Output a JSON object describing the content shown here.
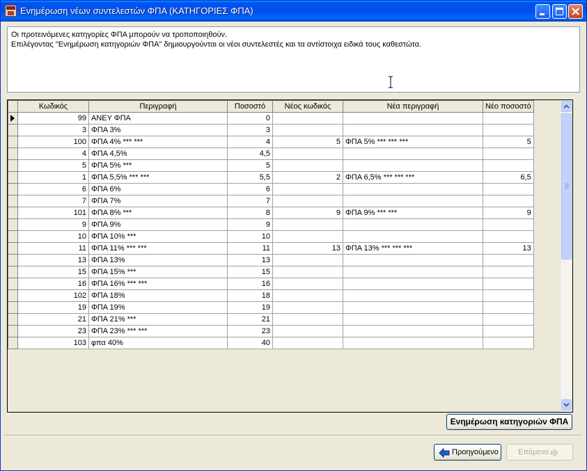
{
  "window": {
    "title": "Ενημέρωση νέων συντελεστών ΦΠΑ (ΚΑΤΗΓΟΡΙΕΣ ΦΠΑ)"
  },
  "message": {
    "line1": "Οι προτεινόμενες κατηγορίες ΦΠΑ μπορούν να τροποποιηθούν.",
    "line2": "Επιλέγοντας \"Ενημέρωση κατηγοριών ΦΠΑ\" δημιουργούνται οι νέοι συντελεστές και τα αντίστοιχα ειδικά τους καθεστώτα."
  },
  "grid": {
    "columns": [
      "Κωδικός",
      "Περιγραφή",
      "Ποσοστό",
      "Νέος κωδικός",
      "Νέα περιγραφή",
      "Νέο ποσοστό"
    ],
    "rows": [
      [
        "99",
        "ΑΝΕΥ ΦΠΑ",
        "0",
        "",
        "",
        ""
      ],
      [
        "3",
        "ΦΠΑ 3%",
        "3",
        "",
        "",
        ""
      ],
      [
        "100",
        "ΦΠΑ 4% *** ***",
        "4",
        "5",
        "ΦΠΑ 5% *** *** ***",
        "5"
      ],
      [
        "4",
        "ΦΠΑ 4,5%",
        "4,5",
        "",
        "",
        ""
      ],
      [
        "5",
        "ΦΠΑ 5% ***",
        "5",
        "",
        "",
        ""
      ],
      [
        "1",
        "ΦΠΑ 5,5% *** ***",
        "5,5",
        "2",
        "ΦΠΑ 6,5% *** *** ***",
        "6,5"
      ],
      [
        "6",
        "ΦΠΑ 6%",
        "6",
        "",
        "",
        ""
      ],
      [
        "7",
        "ΦΠΑ 7%",
        "7",
        "",
        "",
        ""
      ],
      [
        "101",
        "ΦΠΑ 8% ***",
        "8",
        "9",
        "ΦΠΑ 9% *** ***",
        "9"
      ],
      [
        "9",
        "ΦΠΑ 9%",
        "9",
        "",
        "",
        ""
      ],
      [
        "10",
        "ΦΠΑ 10% ***",
        "10",
        "",
        "",
        ""
      ],
      [
        "11",
        "ΦΠΑ 11% *** ***",
        "11",
        "13",
        "ΦΠΑ 13% *** *** ***",
        "13"
      ],
      [
        "13",
        "ΦΠΑ 13%",
        "13",
        "",
        "",
        ""
      ],
      [
        "15",
        "ΦΠΑ 15% ***",
        "15",
        "",
        "",
        ""
      ],
      [
        "16",
        "ΦΠΑ 16% *** ***",
        "16",
        "",
        "",
        ""
      ],
      [
        "102",
        "ΦΠΑ 18%",
        "18",
        "",
        "",
        ""
      ],
      [
        "19",
        "ΦΠΑ 19%",
        "19",
        "",
        "",
        ""
      ],
      [
        "21",
        "ΦΠΑ 21% ***",
        "21",
        "",
        "",
        ""
      ],
      [
        "23",
        "ΦΠΑ 23% *** ***",
        "23",
        "",
        "",
        ""
      ],
      [
        "103",
        "φπα 40%",
        "40",
        "",
        "",
        ""
      ]
    ],
    "current_row": 0
  },
  "buttons": {
    "update_categories": "Ενημέρωση κατηγοριών ΦΠΑ",
    "previous": "Προηγούμενο",
    "next": "Επόμενο"
  },
  "icons": {
    "app": "app-icon",
    "minimize": "minimize-icon",
    "maximize": "maximize-icon",
    "close": "close-icon",
    "back_arrow": "arrow-left-icon",
    "next_arrow": "arrow-right-icon"
  },
  "colors": {
    "titlebar": "#0053ee",
    "close_button": "#c8401c",
    "back_arrow": "#1c5cd8"
  }
}
